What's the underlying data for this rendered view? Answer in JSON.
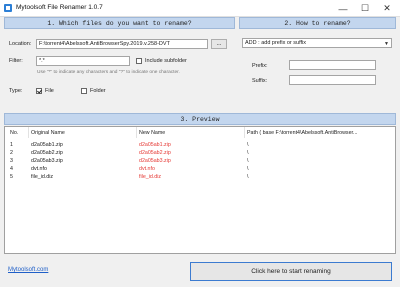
{
  "window": {
    "title": "Mytoolsoft File Renamer 1.0.7",
    "min": "—",
    "max": "☐",
    "close": "✕"
  },
  "section1": {
    "header": "1. Which files do you want to rename?",
    "location_label": "Location:",
    "location_value": "F:\\torrent4\\Abelssoft.AntiBrowserSpy.2019.v.258-DVT",
    "browse_label": "...",
    "filter_label": "Filter:",
    "filter_value": "*.*",
    "include_subfolder": "Include subfolder",
    "hint": "Use \"*\" to indicate any characters and \"?\" to indicate one character.",
    "type_label": "Type:",
    "file_label": "File",
    "folder_label": "Folder"
  },
  "section2": {
    "header": "2. How to rename?",
    "mode": "ADD : add prefix or suffix",
    "prefix_label": "Prefix:",
    "suffix_label": "Suffix:",
    "prefix_value": "",
    "suffix_value": ""
  },
  "section3": {
    "header": "3. Preview",
    "columns": {
      "no": "No.",
      "original": "Original Name",
      "new": "New Name",
      "path": "Path ( base F:\\torrent4\\Abelssoft.AntiBrowser..."
    },
    "rows": [
      {
        "no": "1",
        "original": "d2a05ab1.zip",
        "new": "d2a05ab1.zip",
        "path": "\\"
      },
      {
        "no": "2",
        "original": "d2a05ab2.zip",
        "new": "d2a05ab2.zip",
        "path": "\\"
      },
      {
        "no": "3",
        "original": "d2a05ab3.zip",
        "new": "d2a05ab3.zip",
        "path": "\\"
      },
      {
        "no": "4",
        "original": "dvt.nfo",
        "new": "dvt.nfo",
        "path": "\\"
      },
      {
        "no": "5",
        "original": "file_id.diz",
        "new": "file_id.diz",
        "path": "\\"
      }
    ]
  },
  "footer": {
    "link": "Mytoolsoft.com",
    "start": "Click here to start renaming"
  },
  "colors": {
    "header_bg": "#c3d6ee",
    "new_name": "#e53935",
    "link": "#1f5fc8",
    "start_border": "#3c7bd0"
  }
}
